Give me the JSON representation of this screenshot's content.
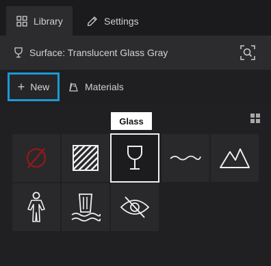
{
  "tabs": [
    {
      "label": "Library",
      "icon": "grid-icon",
      "active": true
    },
    {
      "label": "Settings",
      "icon": "pencil-icon",
      "active": false
    }
  ],
  "surface": {
    "label": "Surface: Translucent Glass Gray",
    "icon": "wine-glass-icon"
  },
  "toolbar": {
    "new_label": "New",
    "materials_label": "Materials"
  },
  "tooltip": "Glass",
  "materials": [
    {
      "name": "none",
      "icon": "no-material-icon"
    },
    {
      "name": "hatch",
      "icon": "hatch-pattern-icon"
    },
    {
      "name": "glass",
      "icon": "wine-glass-icon",
      "selected": true
    },
    {
      "name": "water",
      "icon": "wave-icon"
    },
    {
      "name": "terrain",
      "icon": "mountain-icon"
    },
    {
      "name": "person",
      "icon": "person-icon"
    },
    {
      "name": "waterfall",
      "icon": "waterfall-icon"
    },
    {
      "name": "hidden",
      "icon": "eye-slash-icon"
    }
  ],
  "colors": {
    "accent": "#1a9ad7",
    "none_icon": "#8b1a1a",
    "background": "#1b1b1d"
  }
}
